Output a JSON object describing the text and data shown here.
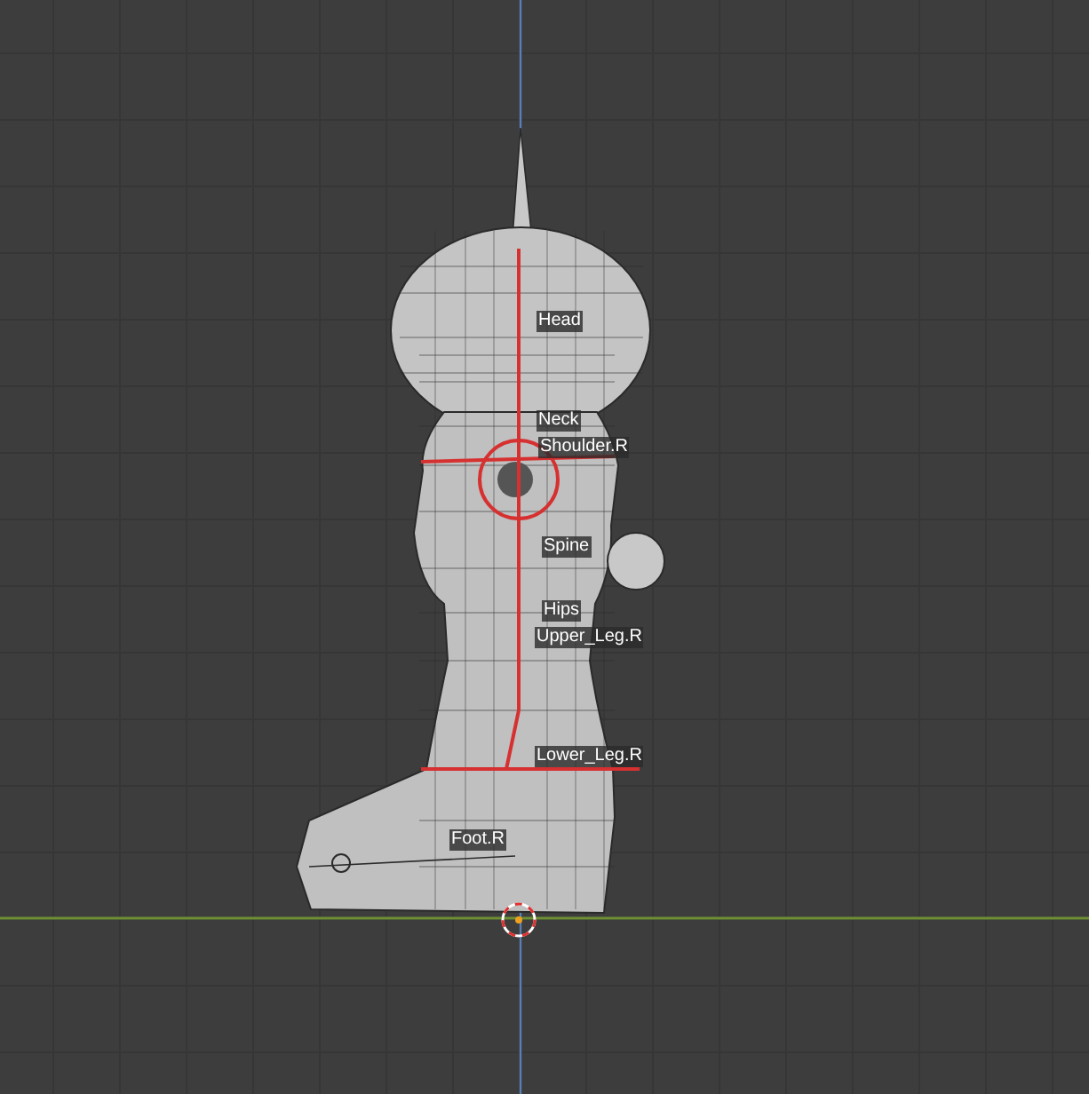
{
  "viewport": {
    "bone_labels": [
      {
        "text": "Head"
      },
      {
        "text": "Neck"
      },
      {
        "text": "Shoulder.R"
      },
      {
        "text": "Spine"
      },
      {
        "text": "Hips"
      },
      {
        "text": "Upper_Leg.R"
      },
      {
        "text": "Lower_Leg.R"
      },
      {
        "text": "Foot.R"
      }
    ]
  }
}
